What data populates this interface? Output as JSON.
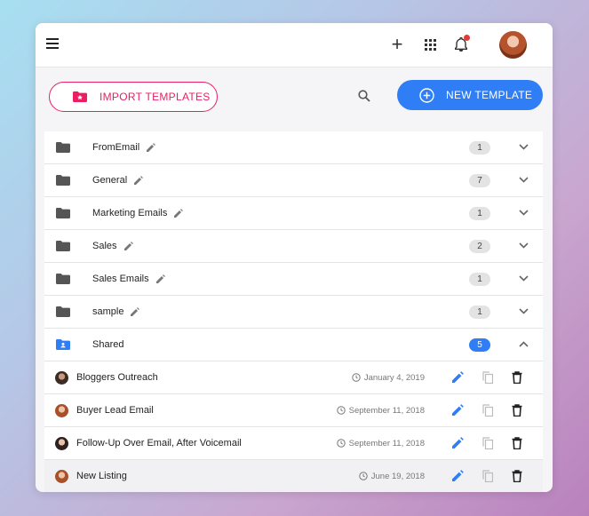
{
  "toolbar": {
    "import_label": "IMPORT TEMPLATES",
    "new_label": "NEW TEMPLATE"
  },
  "folders": [
    {
      "name": "FromEmail",
      "count": "1"
    },
    {
      "name": "General",
      "count": "7"
    },
    {
      "name": "Marketing Emails",
      "count": "1"
    },
    {
      "name": "Sales",
      "count": "2"
    },
    {
      "name": "Sales Emails",
      "count": "1"
    },
    {
      "name": "sample",
      "count": "1"
    }
  ],
  "shared": {
    "name": "Shared",
    "count": "5"
  },
  "templates": [
    {
      "name": "Bloggers Outreach",
      "date": "January 4, 2019"
    },
    {
      "name": "Buyer Lead Email",
      "date": "September 11, 2018"
    },
    {
      "name": "Follow-Up Over Email, After Voicemail",
      "date": "September 11, 2018"
    },
    {
      "name": "New Listing",
      "date": "June 19, 2018"
    }
  ],
  "colors": {
    "accent": "#2f7ef5",
    "import": "#e91e63",
    "notification": "#e53935"
  }
}
